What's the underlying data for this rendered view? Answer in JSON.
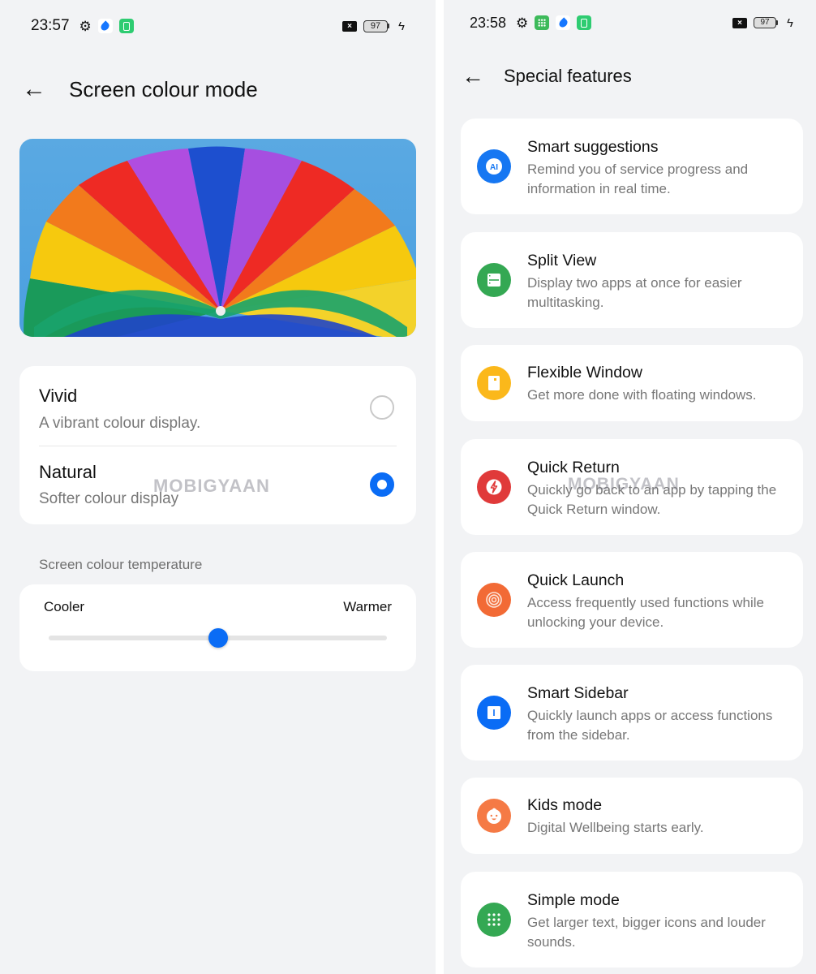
{
  "left_screen": {
    "status_bar": {
      "time": "23:57",
      "notification_icons": [
        "gear-icon",
        "blue-drop-app-icon",
        "battery-saver-app-icon"
      ],
      "battery_level": "97",
      "charging": true
    },
    "header": {
      "title": "Screen colour mode",
      "back_icon": "arrow-left-icon"
    },
    "preview_image": "colourful parachute canopy against blue sky",
    "colour_modes": [
      {
        "name": "Vivid",
        "description": "A vibrant colour display.",
        "selected": false
      },
      {
        "name": "Natural",
        "description": "Softer colour display",
        "selected": true
      }
    ],
    "watermark": "MOBIGYAAN",
    "temperature": {
      "section_label": "Screen colour temperature",
      "min_label": "Cooler",
      "max_label": "Warmer",
      "value_percent": 50
    },
    "accent_color": "#0a6cf5"
  },
  "right_screen": {
    "status_bar": {
      "time": "23:58",
      "notification_icons": [
        "gear-icon",
        "grid-app-icon",
        "blue-drop-app-icon",
        "battery-saver-app-icon"
      ],
      "battery_level": "97",
      "charging": true
    },
    "header": {
      "title": "Special features",
      "back_icon": "arrow-left-icon"
    },
    "watermark": "MOBIGYAAN",
    "features": [
      {
        "name": "Smart suggestions",
        "description": "Remind you of service progress and information in real time.",
        "icon": "ai-icon",
        "color": "#1677f2"
      },
      {
        "name": "Split View",
        "description": "Display two apps at once for easier multitasking.",
        "icon": "split-view-icon",
        "color": "#34a853"
      },
      {
        "name": "Flexible Window",
        "description": "Get more done with floating windows.",
        "icon": "flexible-window-icon",
        "color": "#fbb81b"
      },
      {
        "name": "Quick Return",
        "description": "Quickly go back to an app by tapping the Quick Return window.",
        "icon": "lightning-icon",
        "color": "#e03a3a"
      },
      {
        "name": "Quick Launch",
        "description": "Access frequently used functions while unlocking your device.",
        "icon": "fingerprint-target-icon",
        "color": "#f26a35"
      },
      {
        "name": "Smart Sidebar",
        "description": "Quickly launch apps or access functions from the sidebar.",
        "icon": "sidebar-icon",
        "color": "#0a6cf5"
      },
      {
        "name": "Kids mode",
        "description": "Digital Wellbeing starts early.",
        "icon": "kid-face-icon",
        "color": "#f57a45"
      },
      {
        "name": "Simple mode",
        "description": "Get larger text, bigger icons and louder sounds.",
        "icon": "dots-grid-icon",
        "color": "#34a853"
      }
    ]
  }
}
